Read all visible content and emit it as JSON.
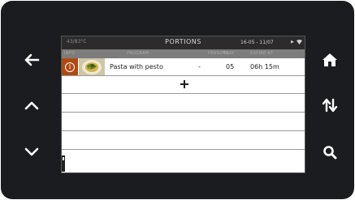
{
  "screen": {
    "temperature": "43/83°C",
    "title": "PORTIONS",
    "datetime": "16-05 - 11/07",
    "status_icons": [
      "play-icon",
      "wifi-icon"
    ]
  },
  "table": {
    "columns": [
      "INFO",
      "PROGRAM",
      "PERSONS",
      "TRAY",
      "EXPIRE AT"
    ],
    "rows": [
      {
        "program": "Pasta with pesto",
        "persons": "-",
        "tray": "05",
        "expire": "06h 15m"
      }
    ],
    "add_label": "+"
  },
  "nav": {
    "left": [
      "back-arrow-icon",
      "chevron-up-icon",
      "chevron-down-icon"
    ],
    "right": [
      "home-icon",
      "sort-icon",
      "search-icon"
    ]
  },
  "colors": {
    "bezel": "#1a1c1f",
    "accent": "#b14a12",
    "header_bar": "#2c2c2c",
    "column_bar": "#7d7d7d"
  }
}
